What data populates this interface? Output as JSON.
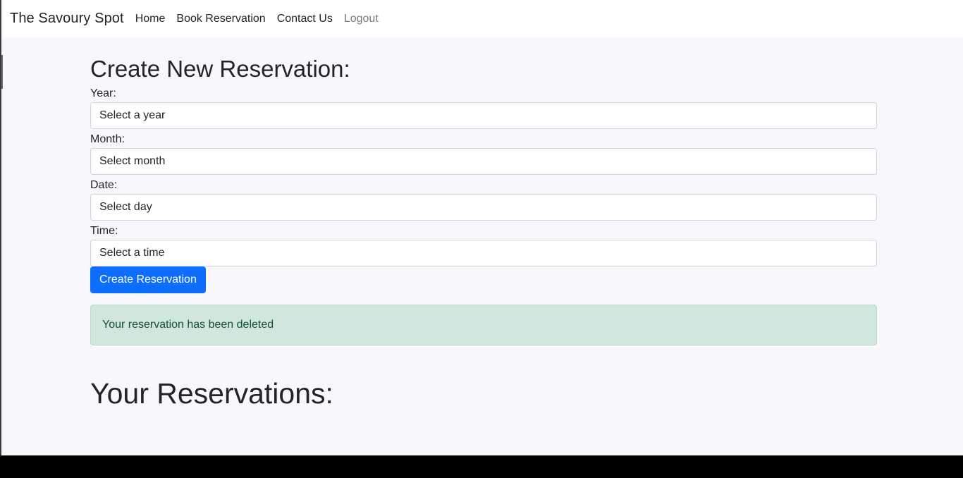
{
  "navbar": {
    "brand": "The Savoury Spot",
    "links": [
      "Home",
      "Book Reservation",
      "Contact Us",
      "Logout"
    ]
  },
  "form": {
    "title": "Create New Reservation:",
    "fields": [
      {
        "label": "Year:",
        "value": "Select a year"
      },
      {
        "label": "Month:",
        "value": "Select month"
      },
      {
        "label": "Date:",
        "value": "Select day"
      },
      {
        "label": "Time:",
        "value": "Select a time"
      }
    ],
    "submit_label": "Create Reservation"
  },
  "alert": {
    "message": "Your reservation has been deleted"
  },
  "reservations": {
    "title": "Your Reservations:"
  },
  "colors": {
    "primary": "#0d6efd",
    "alert_bg": "#d1e7dd",
    "alert_text": "#0f5132"
  }
}
